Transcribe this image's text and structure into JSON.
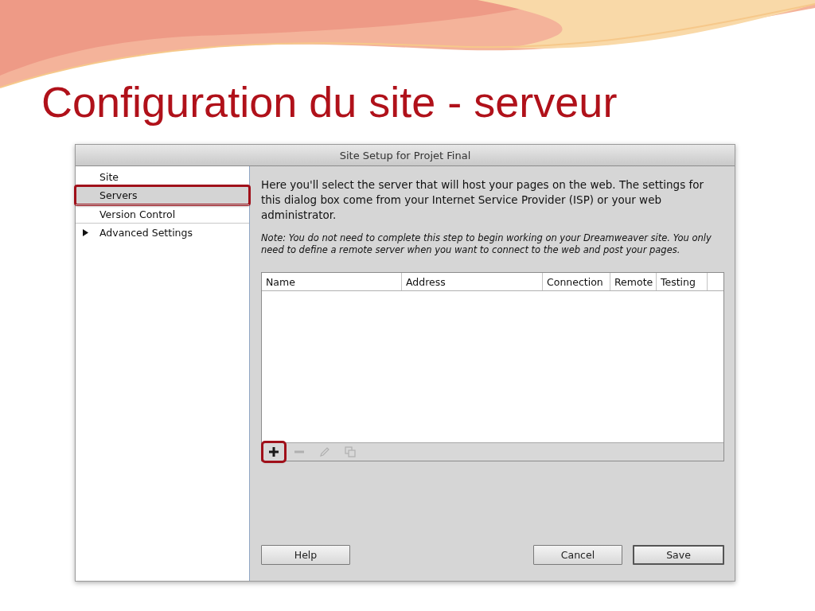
{
  "slide": {
    "title": "Configuration du site - serveur"
  },
  "dialog": {
    "title": "Site Setup for Projet Final",
    "sidebar": {
      "items": [
        {
          "label": "Site",
          "selected": false,
          "highlighted": false
        },
        {
          "label": "Servers",
          "selected": true,
          "highlighted": true
        },
        {
          "label": "Version Control",
          "selected": false,
          "highlighted": false
        },
        {
          "label": "Advanced Settings",
          "selected": false,
          "highlighted": false,
          "expanded": false
        }
      ]
    },
    "intro": "Here you'll select the server that will host your pages on the web. The settings for this dialog box come from your Internet Service Provider (ISP) or your web administrator.",
    "note": "Note: You do not need to complete this step to begin working on your Dreamweaver site. You only need to define a remote server when you want to connect to the web and post your pages.",
    "table": {
      "columns": [
        "Name",
        "Address",
        "Connection",
        "Remote",
        "Testing"
      ]
    },
    "toolbar": [
      {
        "kind": "add",
        "disabled": false,
        "highlighted": true
      },
      {
        "kind": "remove",
        "disabled": true,
        "highlighted": false
      },
      {
        "kind": "edit",
        "disabled": true,
        "highlighted": false
      },
      {
        "kind": "duplicate",
        "disabled": true,
        "highlighted": false
      }
    ],
    "buttons": [
      {
        "label": "Help",
        "default": false
      },
      {
        "label": "Cancel",
        "default": false
      },
      {
        "label": "Save",
        "default": true
      }
    ]
  }
}
